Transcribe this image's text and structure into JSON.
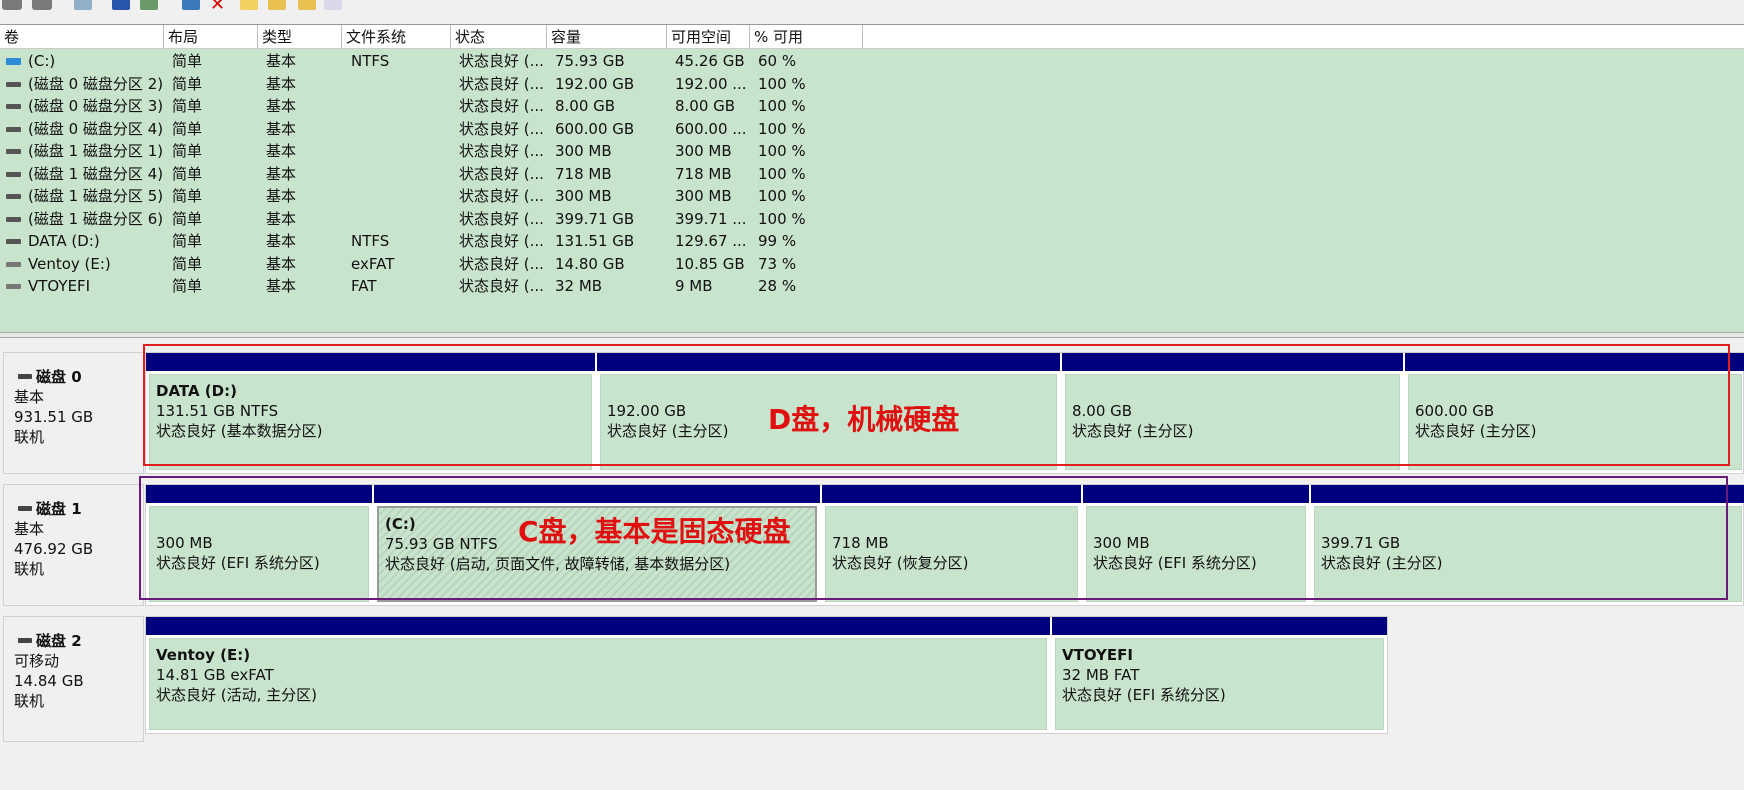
{
  "volume_list": {
    "columns": [
      "卷",
      "布局",
      "类型",
      "文件系统",
      "状态",
      "容量",
      "可用空间",
      "% 可用"
    ],
    "rows": [
      {
        "icon": "system-volume-icon",
        "volume": "(C:)",
        "layout": "简单",
        "type": "基本",
        "fs": "NTFS",
        "status": "状态良好 (...",
        "capacity": "75.93 GB",
        "free": "45.26 GB",
        "pct": "60 %"
      },
      {
        "icon": "volume-icon",
        "volume": "(磁盘 0 磁盘分区 2)",
        "layout": "简单",
        "type": "基本",
        "fs": "",
        "status": "状态良好 (...",
        "capacity": "192.00 GB",
        "free": "192.00 ...",
        "pct": "100 %"
      },
      {
        "icon": "volume-icon",
        "volume": "(磁盘 0 磁盘分区 3)",
        "layout": "简单",
        "type": "基本",
        "fs": "",
        "status": "状态良好 (...",
        "capacity": "8.00 GB",
        "free": "8.00 GB",
        "pct": "100 %"
      },
      {
        "icon": "volume-icon",
        "volume": "(磁盘 0 磁盘分区 4)",
        "layout": "简单",
        "type": "基本",
        "fs": "",
        "status": "状态良好 (...",
        "capacity": "600.00 GB",
        "free": "600.00 ...",
        "pct": "100 %"
      },
      {
        "icon": "volume-icon",
        "volume": "(磁盘 1 磁盘分区 1)",
        "layout": "简单",
        "type": "基本",
        "fs": "",
        "status": "状态良好 (...",
        "capacity": "300 MB",
        "free": "300 MB",
        "pct": "100 %"
      },
      {
        "icon": "volume-icon",
        "volume": "(磁盘 1 磁盘分区 4)",
        "layout": "简单",
        "type": "基本",
        "fs": "",
        "status": "状态良好 (...",
        "capacity": "718 MB",
        "free": "718 MB",
        "pct": "100 %"
      },
      {
        "icon": "volume-icon",
        "volume": "(磁盘 1 磁盘分区 5)",
        "layout": "简单",
        "type": "基本",
        "fs": "",
        "status": "状态良好 (...",
        "capacity": "300 MB",
        "free": "300 MB",
        "pct": "100 %"
      },
      {
        "icon": "volume-icon",
        "volume": "(磁盘 1 磁盘分区 6)",
        "layout": "简单",
        "type": "基本",
        "fs": "",
        "status": "状态良好 (...",
        "capacity": "399.71 GB",
        "free": "399.71 ...",
        "pct": "100 %"
      },
      {
        "icon": "volume-icon",
        "volume": "DATA (D:)",
        "layout": "简单",
        "type": "基本",
        "fs": "NTFS",
        "status": "状态良好 (...",
        "capacity": "131.51 GB",
        "free": "129.67 ...",
        "pct": "99 %"
      },
      {
        "icon": "usb-volume-icon",
        "volume": "Ventoy (E:)",
        "layout": "简单",
        "type": "基本",
        "fs": "exFAT",
        "status": "状态良好 (...",
        "capacity": "14.80 GB",
        "free": "10.85 GB",
        "pct": "73 %"
      },
      {
        "icon": "usb-volume-icon",
        "volume": "VTOYEFI",
        "layout": "简单",
        "type": "基本",
        "fs": "FAT",
        "status": "状态良好 (...",
        "capacity": "32 MB",
        "free": "9 MB",
        "pct": "28 %"
      }
    ]
  },
  "disks": [
    {
      "name": "磁盘 0",
      "kind": "基本",
      "size": "931.51 GB",
      "state": "联机",
      "partitions": [
        {
          "name": "DATA  (D:)",
          "size": "131.51 GB NTFS",
          "status": "状态良好 (基本数据分区)"
        },
        {
          "name": "",
          "size": "192.00 GB",
          "status": "状态良好 (主分区)"
        },
        {
          "name": "",
          "size": "8.00 GB",
          "status": "状态良好 (主分区)"
        },
        {
          "name": "",
          "size": "600.00 GB",
          "status": "状态良好 (主分区)"
        }
      ]
    },
    {
      "name": "磁盘 1",
      "kind": "基本",
      "size": "476.92 GB",
      "state": "联机",
      "partitions": [
        {
          "name": "",
          "size": "300 MB",
          "status": "状态良好 (EFI 系统分区)"
        },
        {
          "name": "(C:)",
          "size": "75.93 GB NTFS",
          "status": "状态良好 (启动, 页面文件, 故障转储, 基本数据分区)",
          "selected": true
        },
        {
          "name": "",
          "size": "718 MB",
          "status": "状态良好 (恢复分区)"
        },
        {
          "name": "",
          "size": "300 MB",
          "status": "状态良好 (EFI 系统分区)"
        },
        {
          "name": "",
          "size": "399.71 GB",
          "status": "状态良好 (主分区)"
        }
      ]
    },
    {
      "name": "磁盘 2",
      "kind": "可移动",
      "size": "14.84 GB",
      "state": "联机",
      "partitions": [
        {
          "name": "Ventoy  (E:)",
          "size": "14.81 GB exFAT",
          "status": "状态良好 (活动, 主分区)"
        },
        {
          "name": "VTOYEFI",
          "size": "32 MB FAT",
          "status": "状态良好 (EFI 系统分区)"
        }
      ]
    }
  ],
  "annotations": {
    "disk0": "D盘，机械硬盘",
    "disk1": "C盘，基本是固态硬盘"
  },
  "colors": {
    "volume_bg": "#c9e4cd",
    "partition_bar": "#00007f",
    "annotation_red": "#e02020",
    "annotation_purple": "#6a1b7a"
  }
}
